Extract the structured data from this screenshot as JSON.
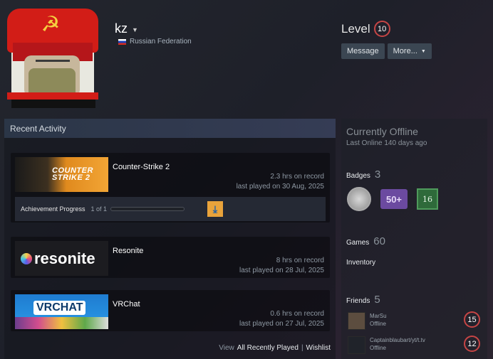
{
  "profile": {
    "name": "kz",
    "country": "Russian Federation",
    "level_label": "Level",
    "level": "10",
    "message_label": "Message",
    "more_label": "More..."
  },
  "recent": {
    "header": "Recent Activity",
    "games": [
      {
        "name": "Counter-Strike 2",
        "hours": "2.3 hrs on record",
        "last_played": "last played on 30 Aug, 2025",
        "capsule_text": "COUNTER STRIKE 2"
      },
      {
        "name": "Resonite",
        "hours": "8 hrs on record",
        "last_played": "last played on 28 Jul, 2025",
        "capsule_text": "resonite"
      },
      {
        "name": "VRChat",
        "hours": "0.6 hrs on record",
        "last_played": "last played on 27 Jul, 2025",
        "capsule_text": "VRCHAT"
      }
    ],
    "achievement": {
      "label": "Achievement Progress",
      "count": "1 of 1",
      "progress": 1.0
    },
    "footer": {
      "view": "View",
      "all_recent": "All Recently Played",
      "sep": "|",
      "wishlist": "Wishlist"
    }
  },
  "sidebar": {
    "status": "Currently Offline",
    "last_online": "Last Online 140 days ago",
    "badges_label": "Badges",
    "badges_count": "3",
    "badge_items": [
      "",
      "50+",
      "16"
    ],
    "games_label": "Games",
    "games_count": "60",
    "inventory_label": "Inventory",
    "friends_label": "Friends",
    "friends_count": "5",
    "friends": [
      {
        "name": "MarSu",
        "status": "Offline",
        "level": "15"
      },
      {
        "name": "Captainblaubart/yt/t.tv",
        "status": "Offline",
        "level": "12"
      }
    ]
  },
  "colors": {
    "level_ring": "#c64545",
    "accent_orange": "#e9a33b"
  }
}
